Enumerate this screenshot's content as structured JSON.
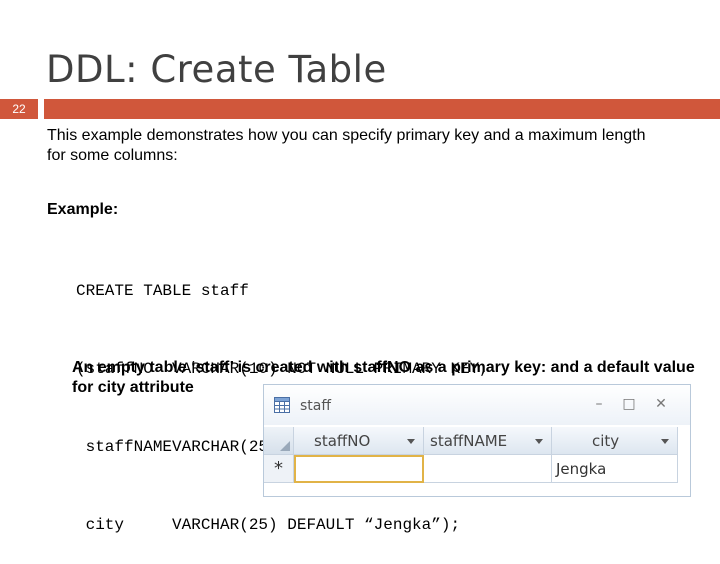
{
  "slide": {
    "title": "DDL: Create Table",
    "number": "22",
    "intro": "This example demonstrates how you can specify primary key and a maximum length for some columns:",
    "example_label": "Example:",
    "code_lines": [
      "CREATE TABLE staff",
      "(staffNO  VARCHAR(10) NOT NULL PRIMARY KEY,",
      " staffNAMEVARCHAR(25),",
      " city     VARCHAR(25) DEFAULT “Jengka”);"
    ],
    "result_text": "An empty table ‘staff’ is created with staffNO as a primary key: and a default value for city attribute"
  },
  "access_window": {
    "title": "staff",
    "minimize_glyph": "–",
    "restore_glyph": "□",
    "close_glyph": "✕",
    "columns": [
      "staffNO",
      "staffNAME",
      "city"
    ],
    "new_row_marker": "*",
    "new_row_values": [
      "",
      "",
      "Jengka"
    ]
  },
  "colors": {
    "accent_bar": "#d0573b",
    "title_text": "#404040"
  }
}
